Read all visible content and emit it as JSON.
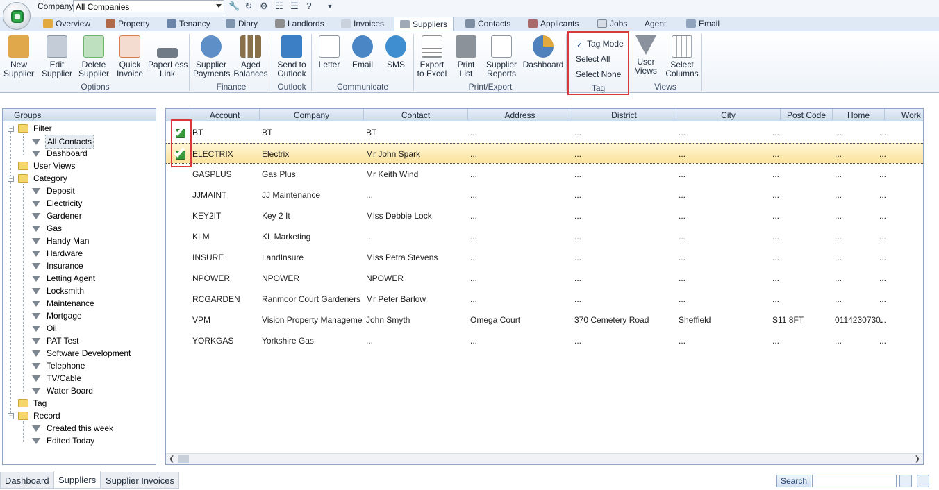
{
  "topbar": {
    "company_label": "Company",
    "company_value": "All Companies"
  },
  "tabs": [
    {
      "label": "Overview",
      "icon": "overview-icon"
    },
    {
      "label": "Property",
      "icon": "property-icon"
    },
    {
      "label": "Tenancy",
      "icon": "tenancy-icon"
    },
    {
      "label": "Diary",
      "icon": "diary-icon"
    },
    {
      "label": "Landlords",
      "icon": "landlords-icon"
    },
    {
      "label": "Invoices",
      "icon": "invoices-icon"
    },
    {
      "label": "Suppliers",
      "icon": "suppliers-icon"
    },
    {
      "label": "Contacts",
      "icon": "contacts-icon"
    },
    {
      "label": "Applicants",
      "icon": "applicants-icon"
    },
    {
      "label": "Jobs",
      "icon": "jobs-icon"
    },
    {
      "label": "Agent",
      "icon": ""
    },
    {
      "label": "Email",
      "icon": "email-icon"
    }
  ],
  "ribbon": {
    "buttons": [
      {
        "line1": "New",
        "line2": "Supplier",
        "icon": "new-supplier-icon",
        "color": "#e0a84a"
      },
      {
        "line1": "Edit",
        "line2": "Supplier",
        "icon": "edit-supplier-icon",
        "color": "#9aa7b7"
      },
      {
        "line1": "Delete",
        "line2": "Supplier",
        "icon": "delete-supplier-icon",
        "color": "#6fb36f"
      },
      {
        "line1": "Quick",
        "line2": "Invoice",
        "icon": "quick-invoice-icon",
        "color": "#d97c4b"
      },
      {
        "line1": "PaperLess",
        "line2": "Link",
        "icon": "paperless-link-icon",
        "color": "#6f7a86"
      },
      {
        "line1": "Supplier",
        "line2": "Payments",
        "icon": "supplier-payments-icon",
        "color": "#5e8fc7"
      },
      {
        "line1": "Aged",
        "line2": "Balances",
        "icon": "aged-balances-icon",
        "color": "#8a7048"
      },
      {
        "line1": "Send to",
        "line2": "Outlook",
        "icon": "send-to-outlook-icon",
        "color": "#3d7fc4"
      },
      {
        "line1": "Letter",
        "line2": "",
        "icon": "letter-icon",
        "color": "#c7cfd8"
      },
      {
        "line1": "Email",
        "line2": "",
        "icon": "email-icon",
        "color": "#4a86c5"
      },
      {
        "line1": "SMS",
        "line2": "",
        "icon": "sms-icon",
        "color": "#3f8fd0"
      },
      {
        "line1": "Export",
        "line2": "to Excel",
        "icon": "export-excel-icon",
        "color": "#8c8f94"
      },
      {
        "line1": "Print",
        "line2": "List",
        "icon": "print-list-icon",
        "color": "#8c929a"
      },
      {
        "line1": "Supplier",
        "line2": "Reports",
        "icon": "supplier-reports-icon",
        "color": "#a7b0bb"
      },
      {
        "line1": "Dashboard",
        "line2": "",
        "icon": "dashboard-icon",
        "color": "#e2a93e"
      },
      {
        "line1": "User",
        "line2": "Views",
        "icon": "user-views-icon",
        "color": "#8a939d"
      },
      {
        "line1": "Select",
        "line2": "Columns",
        "icon": "select-columns-icon",
        "color": "#a3abb5"
      }
    ],
    "groups": [
      "Options",
      "Finance",
      "Outlook",
      "Communicate",
      "Print/Export",
      "Tag",
      "Views"
    ],
    "tag": {
      "tag_mode": "Tag Mode",
      "tag_mode_checked": true,
      "select_all": "Select All",
      "select_none": "Select None"
    }
  },
  "groups_panel": {
    "header": "Groups",
    "filter": {
      "label": "Filter",
      "children": [
        "All Contacts",
        "Dashboard"
      ]
    },
    "user_views": "User Views",
    "category": {
      "label": "Category",
      "children": [
        "Deposit",
        "Electricity",
        "Gardener",
        "Gas",
        "Handy Man",
        "Hardware",
        "Insurance",
        "Letting Agent",
        "Locksmith",
        "Maintenance",
        "Mortgage",
        "Oil",
        "PAT Test",
        "Software Development",
        "Telephone",
        "TV/Cable",
        "Water Board"
      ]
    },
    "tag": "Tag",
    "record": {
      "label": "Record",
      "children": [
        "Created this week",
        "Edited Today"
      ]
    }
  },
  "grid": {
    "columns": [
      "Account",
      "Company",
      "Contact",
      "Address",
      "District",
      "City",
      "Post Code",
      "Home",
      "Work"
    ],
    "rows": [
      {
        "tagged": true,
        "cells": [
          "BT",
          "BT",
          "BT",
          "...",
          "...",
          "...",
          "...",
          "...",
          "..."
        ]
      },
      {
        "tagged": true,
        "selected": true,
        "cells": [
          "ELECTRIX",
          "Electrix",
          "Mr John Spark",
          "...",
          "...",
          "...",
          "...",
          "...",
          "..."
        ]
      },
      {
        "tagged": false,
        "cells": [
          "GASPLUS",
          "Gas Plus",
          "Mr Keith Wind",
          "...",
          "...",
          "...",
          "...",
          "...",
          "..."
        ]
      },
      {
        "tagged": false,
        "cells": [
          "JJMAINT",
          "JJ Maintenance",
          "...",
          "...",
          "...",
          "...",
          "...",
          "...",
          "..."
        ]
      },
      {
        "tagged": false,
        "cells": [
          "KEY2IT",
          "Key 2 It",
          "Miss Debbie Lock",
          "...",
          "...",
          "...",
          "...",
          "...",
          "..."
        ]
      },
      {
        "tagged": false,
        "cells": [
          "KLM",
          "KL Marketing",
          "...",
          "...",
          "...",
          "...",
          "...",
          "...",
          "..."
        ]
      },
      {
        "tagged": false,
        "cells": [
          "INSURE",
          "LandInsure",
          "Miss Petra Stevens",
          "...",
          "...",
          "...",
          "...",
          "...",
          "..."
        ]
      },
      {
        "tagged": false,
        "cells": [
          "NPOWER",
          "NPOWER",
          "NPOWER",
          "...",
          "...",
          "...",
          "...",
          "...",
          "..."
        ]
      },
      {
        "tagged": false,
        "cells": [
          "RCGARDEN",
          "Ranmoor Court Gardeners",
          "Mr Peter Barlow",
          "...",
          "...",
          "...",
          "...",
          "...",
          "..."
        ]
      },
      {
        "tagged": false,
        "cells": [
          "VPM",
          "Vision Property Management...",
          "John Smyth",
          "Omega Court",
          "370 Cemetery Road",
          "Sheffield",
          "S11 8FT",
          "0114230730...",
          "..."
        ]
      },
      {
        "tagged": false,
        "cells": [
          "YORKGAS",
          "Yorkshire Gas",
          "...",
          "...",
          "...",
          "...",
          "...",
          "...",
          "..."
        ]
      }
    ]
  },
  "bottom_tabs": [
    "Dashboard",
    "Suppliers",
    "Supplier Invoices"
  ],
  "search": {
    "button_label": "Search",
    "placeholder": ""
  },
  "colors": {
    "accent": "#d9393b",
    "selection": "#fbe19a",
    "tick": "#3a9a3c"
  }
}
